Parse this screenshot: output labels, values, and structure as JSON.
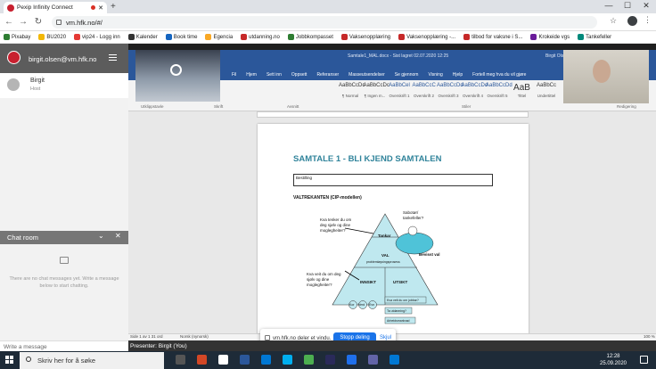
{
  "browser": {
    "tab_title": "Pexip Infinity Connect",
    "new_tab": "+",
    "url": "vm.hfk.no/#/",
    "window_controls": [
      "—",
      "☐",
      "✕"
    ]
  },
  "bookmarks": [
    {
      "label": "Pixabay",
      "color": "#2e7d32"
    },
    {
      "label": "BU2020",
      "color": "#f2b705"
    },
    {
      "label": "vip24 - Logg inn",
      "color": "#e53935"
    },
    {
      "label": "Kalender",
      "color": "#333333"
    },
    {
      "label": "Book time",
      "color": "#1565c0"
    },
    {
      "label": "Egencia",
      "color": "#f9a825"
    },
    {
      "label": "utdanning.no",
      "color": "#c62828"
    },
    {
      "label": "Jobbkompasset",
      "color": "#2e7d32"
    },
    {
      "label": "Vaksenopplæring",
      "color": "#c62828"
    },
    {
      "label": "Vaksenopplæring -...",
      "color": "#c62828"
    },
    {
      "label": "tilbod for vaksne i S...",
      "color": "#c62828"
    },
    {
      "label": "Krokeide vgs",
      "color": "#6a1b9a"
    },
    {
      "label": "Tankefeller",
      "color": "#00897b"
    }
  ],
  "sidebar": {
    "account": "birgit.olsen@vm.hfk.no",
    "participant_name": "Birgit",
    "participant_role": "Host",
    "chat_title": "Chat room",
    "chat_empty": "There are no chat messages yet. Write a message below to start chatting.",
    "chat_placeholder": "Write a message",
    "accent": "#c8202f"
  },
  "word": {
    "title": "Samtale1_MAL.docx - Sist lagret 02.07.2020 12:25",
    "user": "Birgit Olsen",
    "menu": [
      "Fil",
      "Hjem",
      "Sett inn",
      "Oppsett",
      "Referanser",
      "Masseutsendelser",
      "Se gjennom",
      "Visning",
      "Hjelp",
      "Fortell meg hva du vil gjøre"
    ],
    "styles": [
      {
        "preview": "AaBbCcDc",
        "name": "¶ Normal"
      },
      {
        "preview": "AaBbCcDc",
        "name": "¶ Ingen m..."
      },
      {
        "preview": "AaBbCel",
        "name": "Overskrift 1"
      },
      {
        "preview": "AaBbCcC",
        "name": "Overskrift 2"
      },
      {
        "preview": "AaBbCcDd",
        "name": "Overskrift 3"
      },
      {
        "preview": "AaBbCcDd",
        "name": "Overskrift 4"
      },
      {
        "preview": "AaBbCcDd",
        "name": "Overskrift 5"
      },
      {
        "preview": "AaB",
        "name": "Tittel"
      },
      {
        "preview": "AaBbCc",
        "name": "Undertittel"
      }
    ],
    "sections": [
      "Utklippstavle",
      "Skrift",
      "Avsnitt",
      "Stiler",
      "Redigering"
    ],
    "doc_title": "SAMTALE 1 - BLI KJEND SAMTALEN",
    "bestilling": "Bestilling",
    "val_title": "VALTREKANTEN (CIP-modellen)",
    "diagram": {
      "q1": "Kva tenker du om deg sjølv og dine moglegheiter?",
      "q2": "Sabotør/ tankefeller?",
      "tankar": "Tankar",
      "val": "VAL",
      "prosess": "problemløysingsprosess",
      "bevisst": "Bevisst val",
      "q3": "Kva veit du om deg sjølv og dine moglegheiter?",
      "innsikt": "INNSIKT",
      "utsikt": "UTSIKT",
      "c1": "Kor",
      "c2": "Verd",
      "c3": "Evn",
      "b1": "Kva veit du om jobbar?",
      "b2": "Ta utdanning?",
      "b3": "Arbeidsmarknad"
    },
    "status_left": "Side 1 av 1   31 ord",
    "status_lang": "Norsk (nynorsk)",
    "zoom": "100 %",
    "accent": "#2b579a"
  },
  "share": {
    "text": "vm.hfk.no deler et vindu.",
    "stop": "Stopp deling",
    "hide": "Skjul"
  },
  "presenter": "Presenter: Birgit (You)",
  "taskbar": {
    "search": "Skriv her for å søke",
    "time": "12:28",
    "date": "25.09.2020"
  }
}
